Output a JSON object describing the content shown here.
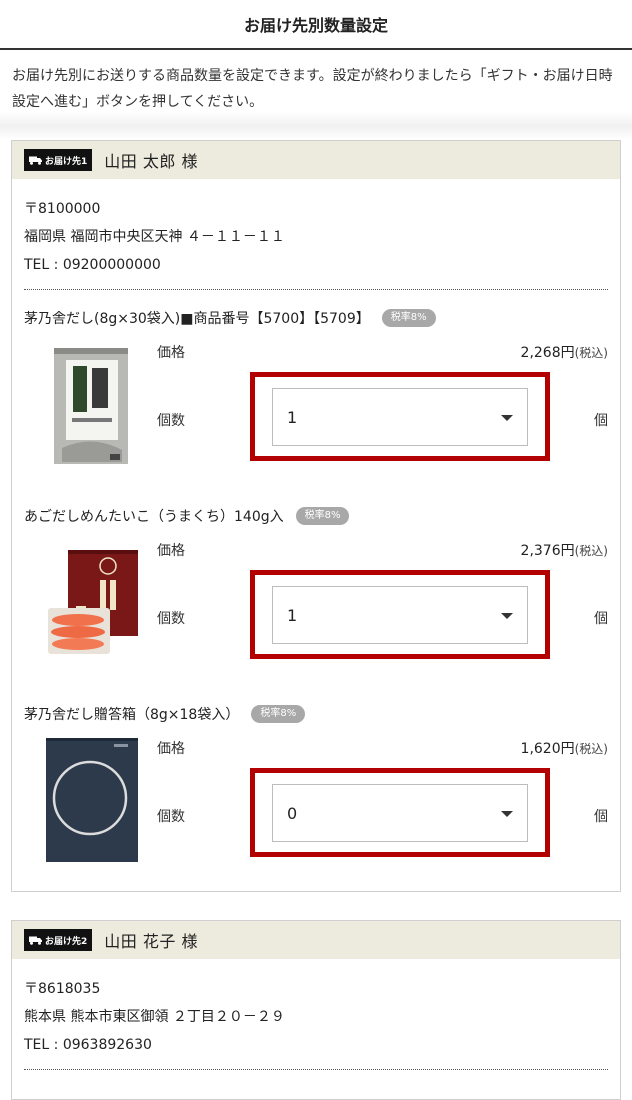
{
  "header": {
    "title": "お届け先別数量設定"
  },
  "intro": {
    "text": "お届け先別にお送りする商品数量を設定できます。設定が終わりましたら「ギフト・お届け日時設定へ進む」ボタンを押してください。"
  },
  "labels": {
    "price": "価格",
    "quantity": "個数",
    "unit": "個",
    "tax_included": "(税込)"
  },
  "destinations": [
    {
      "badge": "お届け先1",
      "name": "山田 太郎 様",
      "postal": "〒8100000",
      "address": "福岡県 福岡市中央区天神 ４－１１－１１",
      "tel": "TEL : 09200000000",
      "items": [
        {
          "title": "茅乃舎だし(8g×30袋入)■商品番号【5700】【5709】",
          "tax_rate": "税率8%",
          "price": "2,268円",
          "quantity": "1"
        },
        {
          "title": "あごだしめんたいこ（うまくち）140g入",
          "tax_rate": "税率8%",
          "price": "2,376円",
          "quantity": "1"
        },
        {
          "title": "茅乃舎だし贈答箱（8g×18袋入）",
          "tax_rate": "税率8%",
          "price": "1,620円",
          "quantity": "0"
        }
      ]
    },
    {
      "badge": "お届け先2",
      "name": "山田 花子 様",
      "postal": "〒8618035",
      "address": "熊本県 熊本市東区御領 ２丁目２０－２９",
      "tel": "TEL : 0963892630"
    }
  ]
}
